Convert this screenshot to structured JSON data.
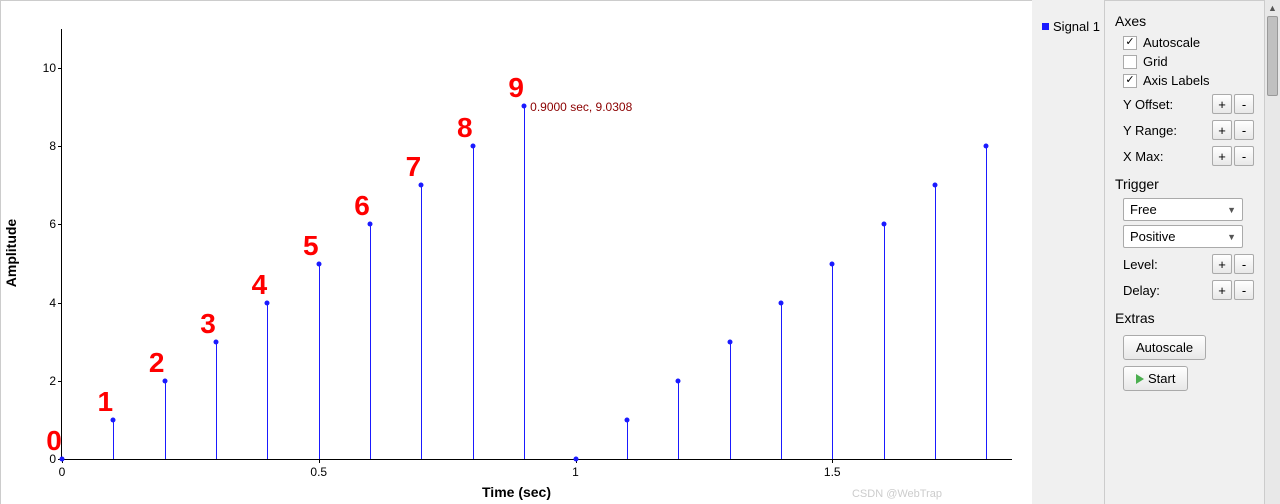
{
  "chart_data": {
    "type": "stem",
    "xlabel": "Time (sec)",
    "ylabel": "Amplitude",
    "xlim": [
      0,
      1.85
    ],
    "ylim": [
      0,
      11
    ],
    "xticks": [
      0,
      0.5,
      1,
      1.5
    ],
    "yticks": [
      0,
      2,
      4,
      6,
      8,
      10
    ],
    "series": [
      {
        "name": "Signal 1",
        "x": [
          0,
          0.1,
          0.2,
          0.3,
          0.4,
          0.5,
          0.6,
          0.7,
          0.8,
          0.9,
          1.0,
          1.1,
          1.2,
          1.3,
          1.4,
          1.5,
          1.6,
          1.7,
          1.8
        ],
        "y": [
          0,
          1,
          2,
          3,
          4,
          5,
          6,
          7,
          8,
          9.0308,
          0,
          1,
          2,
          3,
          4,
          5,
          6,
          7,
          8
        ]
      }
    ],
    "annotations": {
      "red_numbers": [
        "0",
        "1",
        "2",
        "3",
        "4",
        "5",
        "6",
        "7",
        "8",
        "9"
      ],
      "tooltip": "0.9000 sec, 9.0308"
    }
  },
  "legend": {
    "label": "Signal 1"
  },
  "panel": {
    "axes": {
      "title": "Axes",
      "autoscale": {
        "label": "Autoscale",
        "checked": true
      },
      "grid": {
        "label": "Grid",
        "checked": false
      },
      "axislabels": {
        "label": "Axis Labels",
        "checked": true
      },
      "yoffset": "Y Offset:",
      "yrange": "Y Range:",
      "xmax": "X Max:"
    },
    "trigger": {
      "title": "Trigger",
      "mode": "Free",
      "slope": "Positive",
      "level": "Level:",
      "delay": "Delay:"
    },
    "extras": {
      "title": "Extras",
      "autoscale_btn": "Autoscale",
      "start_btn": "Start"
    }
  },
  "watermark": "CSDN @WebTrap"
}
